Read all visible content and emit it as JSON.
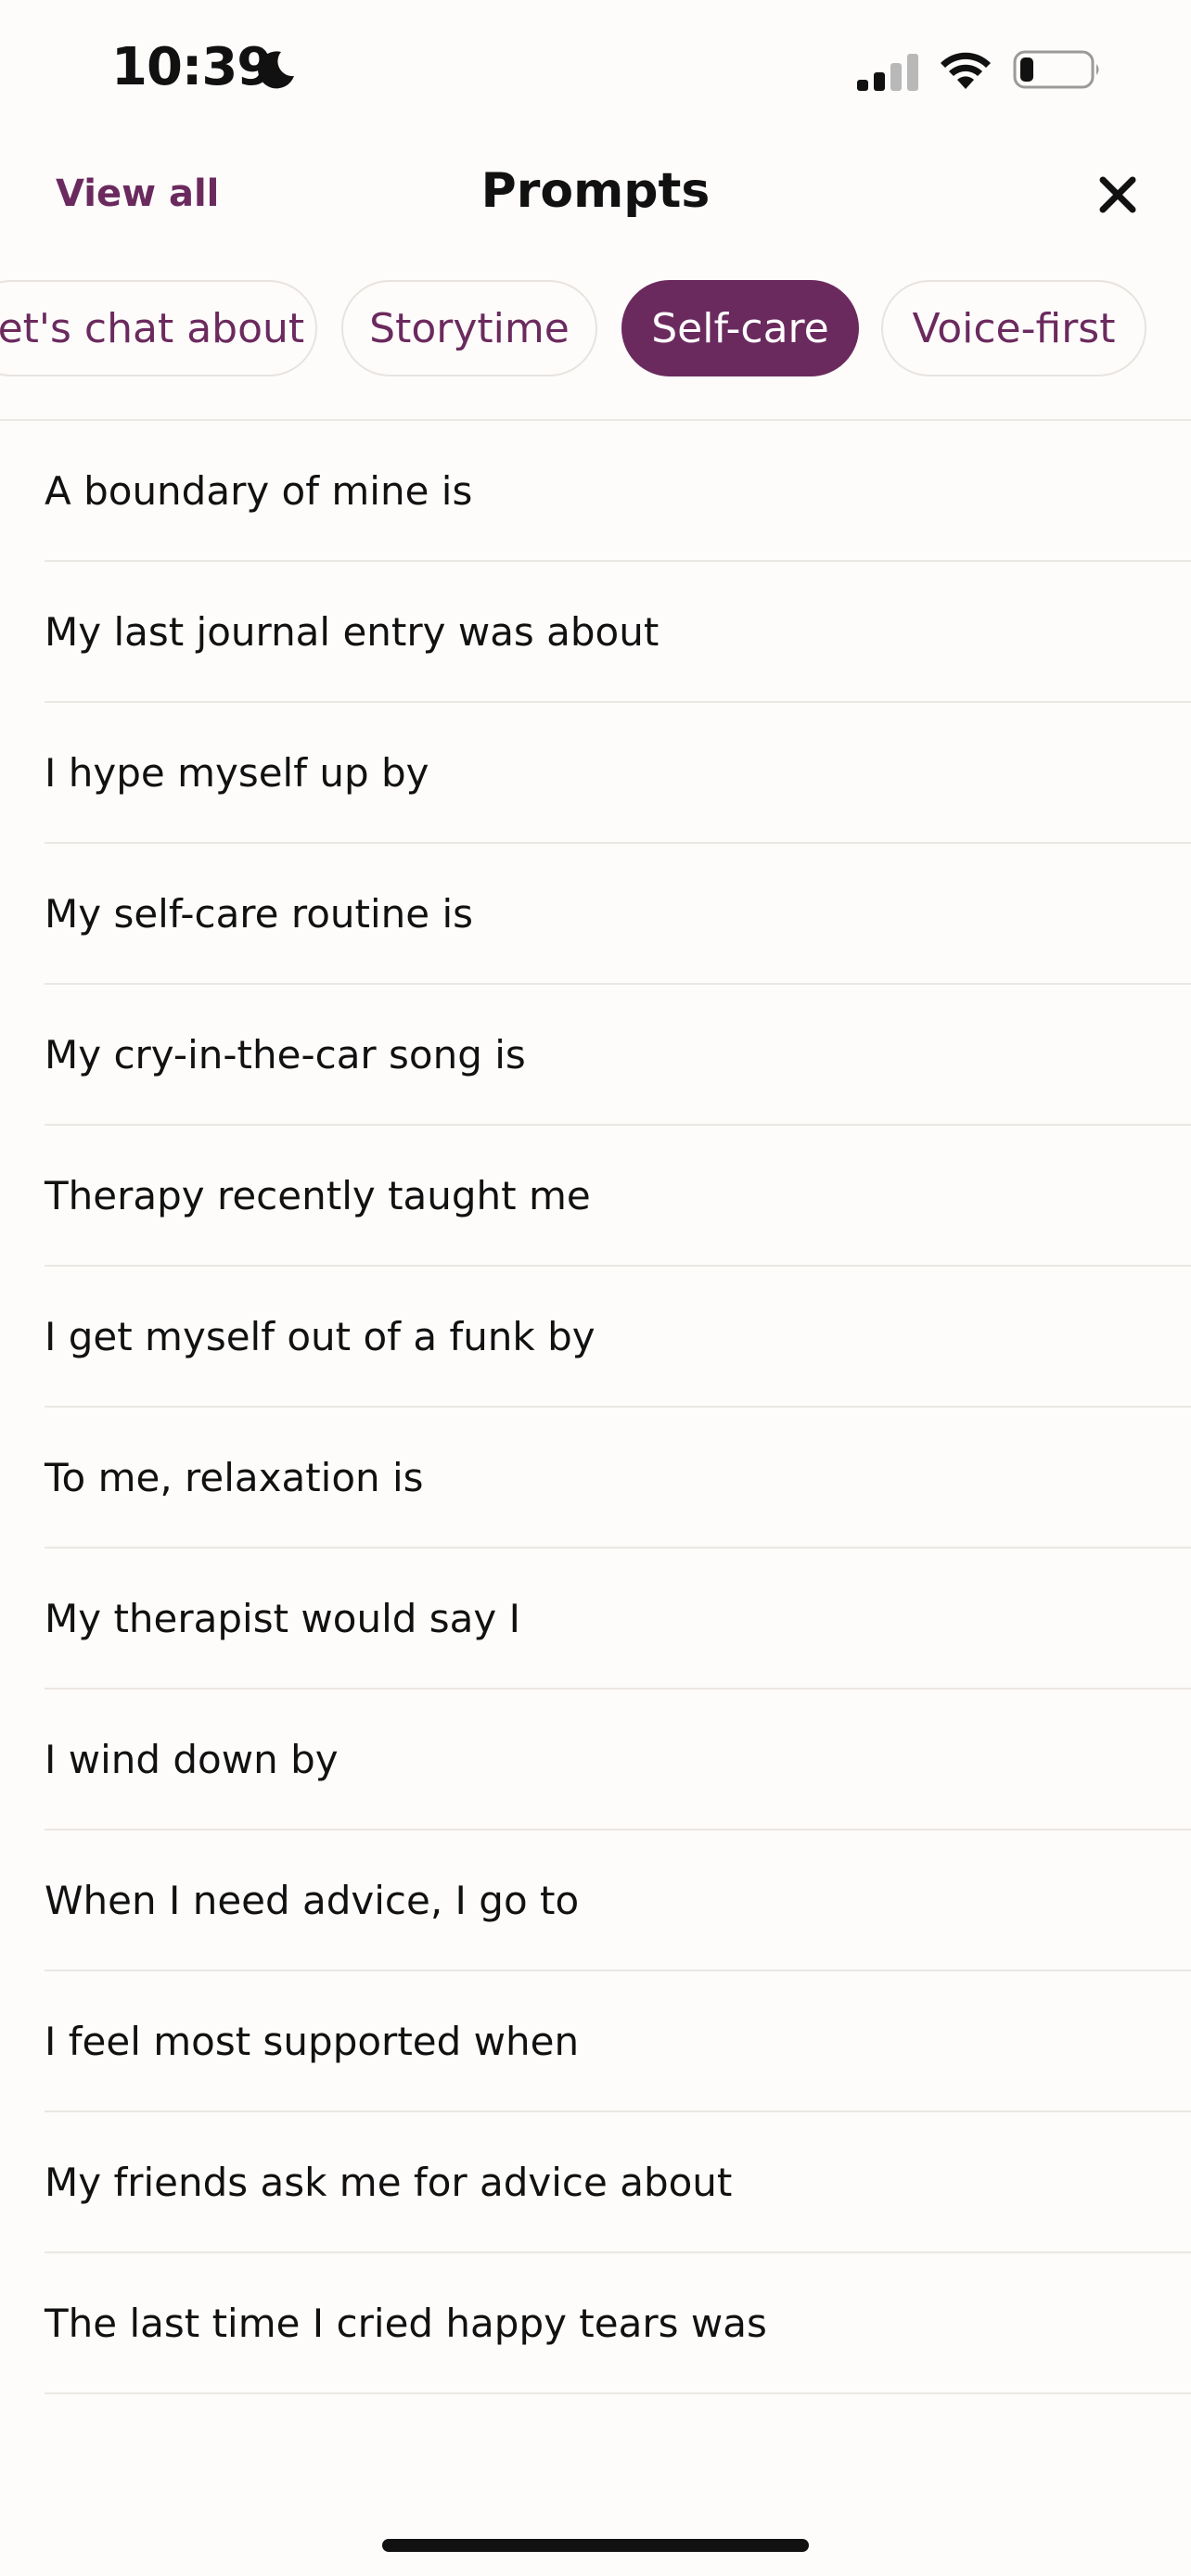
{
  "status_bar": {
    "time": "10:39",
    "icons": [
      "moon-icon",
      "signal-icon",
      "wifi-icon",
      "battery-icon"
    ]
  },
  "header": {
    "view_all_label": "View all",
    "title": "Prompts",
    "close_icon": "close-icon"
  },
  "tabs": [
    {
      "label": "Let's chat about",
      "active": false
    },
    {
      "label": "Storytime",
      "active": false
    },
    {
      "label": "Self-care",
      "active": true
    },
    {
      "label": "Voice-first",
      "active": false
    }
  ],
  "prompts": [
    "A boundary of mine is",
    "My last journal entry was about",
    "I hype myself up by",
    "My self-care routine is",
    "My cry-in-the-car song is",
    "Therapy recently taught me",
    "I get myself out of a funk by",
    "To me, relaxation is",
    "My therapist would say I",
    "I wind down by",
    "When I need advice, I go to",
    "I feel most supported when",
    "My friends ask me for advice about",
    "The last time I cried happy tears was"
  ],
  "colors": {
    "accent": "#6b2a5e",
    "background": "#fdfcfb",
    "divider": "#ebe7e3",
    "text": "#111111"
  }
}
